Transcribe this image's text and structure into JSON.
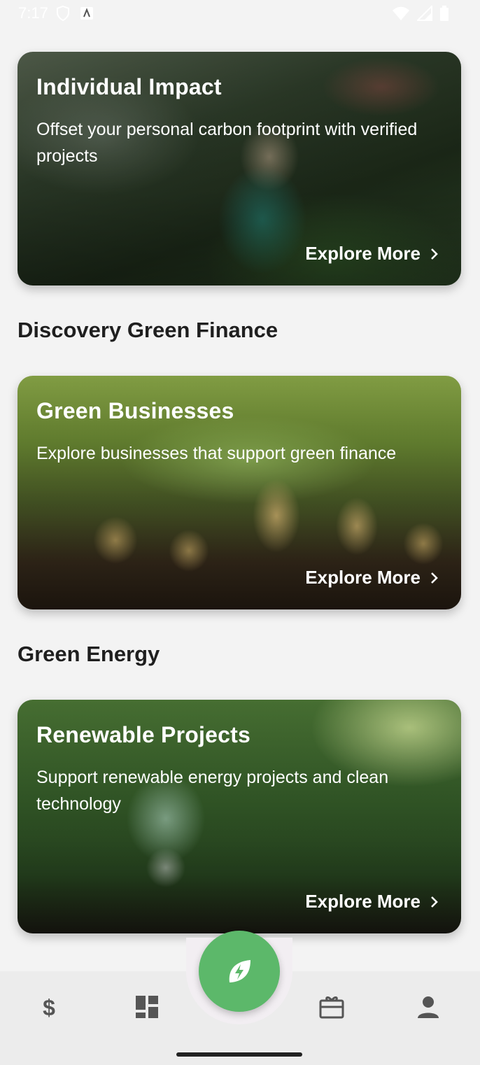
{
  "status_bar": {
    "time": "7:17"
  },
  "cards": [
    {
      "title": "Individual Impact",
      "description": "Offset your personal carbon footprint with verified projects",
      "explore_label": "Explore More"
    },
    {
      "title": "Green Businesses",
      "description": "Explore businesses that support green finance",
      "explore_label": "Explore More"
    },
    {
      "title": "Renewable Projects",
      "description": "Support renewable energy projects and clean technology",
      "explore_label": "Explore More"
    }
  ],
  "sections": {
    "discovery": "Discovery Green Finance",
    "energy": "Green Energy"
  },
  "bottom_nav": {
    "items": [
      "dollar-icon",
      "dashboard-icon",
      "leaf-bolt-icon",
      "gift-card-icon",
      "person-icon"
    ],
    "accent": "#5cb86a"
  }
}
